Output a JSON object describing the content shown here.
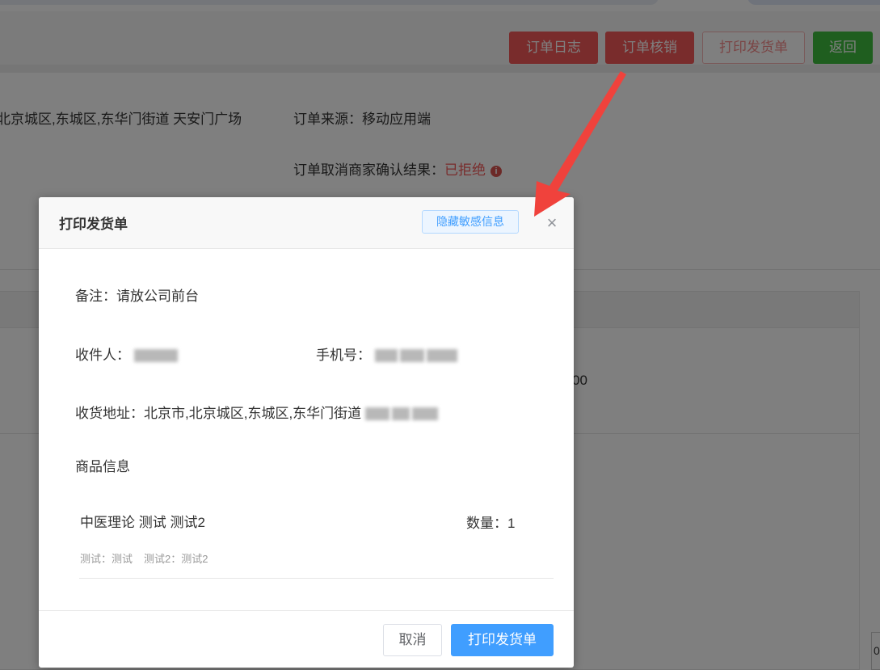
{
  "toolbar": {
    "order_log": "订单日志",
    "order_verify": "订单核销",
    "print_delivery": "打印发货单",
    "back": "返回"
  },
  "background": {
    "address_fragment": "北京城区,东城区,东华门街道 天安门广场",
    "order_source": "订单来源：移动应用端",
    "cancel_result_label": "订单取消商家确认结果：",
    "cancel_result_value": "已拒绝",
    "info_icon": "i",
    "amount_fragment": "00",
    "corner_fragment": "0"
  },
  "modal": {
    "title": "打印发货单",
    "hide_sensitive": "隐藏敏感信息",
    "close_icon": "×",
    "remark": "备注：请放公司前台",
    "recipient_label": "收件人：",
    "phone_label": "手机号：",
    "address_label": "收货地址：",
    "address_value": "北京市,北京城区,东城区,东华门街道",
    "goods_title": "商品信息",
    "goods": {
      "name": "中医理论 测试 测试2",
      "quantity": "数量：1",
      "spec1": "测试：测试",
      "spec2": "测试2：测试2"
    },
    "cancel": "取消",
    "print": "打印发货单"
  },
  "colors": {
    "danger": "#f25858",
    "success": "#3fbd3f",
    "primary": "#409eff",
    "annotation_arrow": "#f0423c"
  }
}
